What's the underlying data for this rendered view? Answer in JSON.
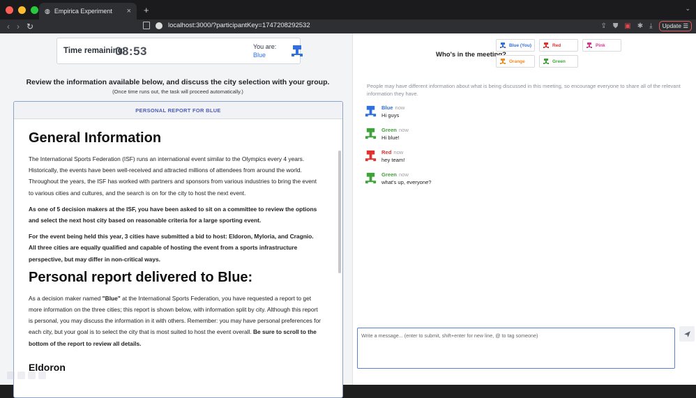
{
  "browser": {
    "tab_title": "Empirica Experiment",
    "url": "localhost:3000/?participantKey=1747208292532",
    "update_label": "Update"
  },
  "timer": {
    "label": "Time remaining:",
    "value": "08:53",
    "you_are_label": "You are:",
    "you_are_name": "Blue"
  },
  "instructions": {
    "heading": "Review the information available below, and discuss the city selection with your group.",
    "subheading": "(Once time runs out, the task will proceed automatically.)"
  },
  "report": {
    "header": "PERSONAL REPORT FOR BLUE",
    "general_title": "General Information",
    "para1": "The International Sports Federation (ISF) runs an international event similar to the Olympics every 4 years. Historically, the events have been well-received and attracted millions of attendees from around the world. Throughout the years, the ISF has worked with partners and sponsors from various industries to bring the event to various cities and cultures, and the search is on for the city to host the next event.",
    "para2": "As one of 5 decision makers at the ISF, you have been asked to sit on a committee to review the options and select the next host city based on reasonable criteria for a large sporting event.",
    "para3": "For the event being held this year, 3 cities have submitted a bid to host: Eldoron, Myloria, and Cragnio. All three cities are equally qualified and capable of hosting the event from a sports infrastructure perspective, but may differ in non-critical ways.",
    "personal_title": "Personal report delivered to Blue:",
    "para4_a": "As a decision maker named ",
    "para4_name": "\"Blue\"",
    "para4_b": " at the International Sports Federation, you have requested a report to get more information on the three cities; this report is shown below, with information split by city. Although this report is personal, you may discuss the information in it with others. Remember: you may have personal preferences for each city, but your goal is to select the city that is most suited to host the event overall. ",
    "para4_bold": "Be sure to scroll to the bottom of the report to review all details.",
    "city_title": "Eldoron"
  },
  "meeting": {
    "who_label": "Who's in the meeting?",
    "participants": [
      {
        "name": "Blue (You)",
        "color": "#2f6fe0"
      },
      {
        "name": "Red",
        "color": "#e0312e"
      },
      {
        "name": "Pink",
        "color": "#d9358f"
      },
      {
        "name": "Orange",
        "color": "#f08a1c"
      },
      {
        "name": "Green",
        "color": "#3fa33a"
      }
    ],
    "notice": "People may have different information about what is being discussed in this meeting, so encourage everyone to share all of the relevant information they have."
  },
  "chat": {
    "messages": [
      {
        "name": "Blue",
        "time": "now",
        "text": "Hi guys",
        "color": "#2f6fe0"
      },
      {
        "name": "Green",
        "time": "now",
        "text": "Hi blue!",
        "color": "#3fa33a"
      },
      {
        "name": "Red",
        "time": "now",
        "text": "hey team!",
        "color": "#e0312e"
      },
      {
        "name": "Green",
        "time": "now",
        "text": "what's up, everyone?",
        "color": "#3fa33a"
      }
    ],
    "composer_placeholder": "Write a message... (enter to submit, shift+enter for new line, @ to tag someone)"
  }
}
